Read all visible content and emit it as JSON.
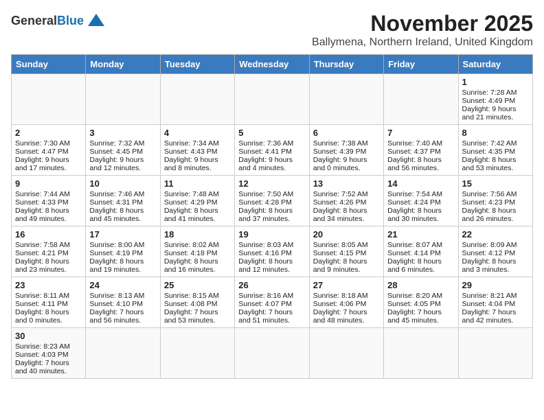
{
  "header": {
    "logo_line1": "General",
    "logo_line2": "Blue",
    "title": "November 2025",
    "subtitle": "Ballymena, Northern Ireland, United Kingdom"
  },
  "weekdays": [
    "Sunday",
    "Monday",
    "Tuesday",
    "Wednesday",
    "Thursday",
    "Friday",
    "Saturday"
  ],
  "weeks": [
    [
      {
        "day": "",
        "info": ""
      },
      {
        "day": "",
        "info": ""
      },
      {
        "day": "",
        "info": ""
      },
      {
        "day": "",
        "info": ""
      },
      {
        "day": "",
        "info": ""
      },
      {
        "day": "",
        "info": ""
      },
      {
        "day": "1",
        "info": "Sunrise: 7:28 AM\nSunset: 4:49 PM\nDaylight: 9 hours and 21 minutes."
      }
    ],
    [
      {
        "day": "2",
        "info": "Sunrise: 7:30 AM\nSunset: 4:47 PM\nDaylight: 9 hours and 17 minutes."
      },
      {
        "day": "3",
        "info": "Sunrise: 7:32 AM\nSunset: 4:45 PM\nDaylight: 9 hours and 12 minutes."
      },
      {
        "day": "4",
        "info": "Sunrise: 7:34 AM\nSunset: 4:43 PM\nDaylight: 9 hours and 8 minutes."
      },
      {
        "day": "5",
        "info": "Sunrise: 7:36 AM\nSunset: 4:41 PM\nDaylight: 9 hours and 4 minutes."
      },
      {
        "day": "6",
        "info": "Sunrise: 7:38 AM\nSunset: 4:39 PM\nDaylight: 9 hours and 0 minutes."
      },
      {
        "day": "7",
        "info": "Sunrise: 7:40 AM\nSunset: 4:37 PM\nDaylight: 8 hours and 56 minutes."
      },
      {
        "day": "8",
        "info": "Sunrise: 7:42 AM\nSunset: 4:35 PM\nDaylight: 8 hours and 53 minutes."
      }
    ],
    [
      {
        "day": "9",
        "info": "Sunrise: 7:44 AM\nSunset: 4:33 PM\nDaylight: 8 hours and 49 minutes."
      },
      {
        "day": "10",
        "info": "Sunrise: 7:46 AM\nSunset: 4:31 PM\nDaylight: 8 hours and 45 minutes."
      },
      {
        "day": "11",
        "info": "Sunrise: 7:48 AM\nSunset: 4:29 PM\nDaylight: 8 hours and 41 minutes."
      },
      {
        "day": "12",
        "info": "Sunrise: 7:50 AM\nSunset: 4:28 PM\nDaylight: 8 hours and 37 minutes."
      },
      {
        "day": "13",
        "info": "Sunrise: 7:52 AM\nSunset: 4:26 PM\nDaylight: 8 hours and 34 minutes."
      },
      {
        "day": "14",
        "info": "Sunrise: 7:54 AM\nSunset: 4:24 PM\nDaylight: 8 hours and 30 minutes."
      },
      {
        "day": "15",
        "info": "Sunrise: 7:56 AM\nSunset: 4:23 PM\nDaylight: 8 hours and 26 minutes."
      }
    ],
    [
      {
        "day": "16",
        "info": "Sunrise: 7:58 AM\nSunset: 4:21 PM\nDaylight: 8 hours and 23 minutes."
      },
      {
        "day": "17",
        "info": "Sunrise: 8:00 AM\nSunset: 4:19 PM\nDaylight: 8 hours and 19 minutes."
      },
      {
        "day": "18",
        "info": "Sunrise: 8:02 AM\nSunset: 4:18 PM\nDaylight: 8 hours and 16 minutes."
      },
      {
        "day": "19",
        "info": "Sunrise: 8:03 AM\nSunset: 4:16 PM\nDaylight: 8 hours and 12 minutes."
      },
      {
        "day": "20",
        "info": "Sunrise: 8:05 AM\nSunset: 4:15 PM\nDaylight: 8 hours and 9 minutes."
      },
      {
        "day": "21",
        "info": "Sunrise: 8:07 AM\nSunset: 4:14 PM\nDaylight: 8 hours and 6 minutes."
      },
      {
        "day": "22",
        "info": "Sunrise: 8:09 AM\nSunset: 4:12 PM\nDaylight: 8 hours and 3 minutes."
      }
    ],
    [
      {
        "day": "23",
        "info": "Sunrise: 8:11 AM\nSunset: 4:11 PM\nDaylight: 8 hours and 0 minutes."
      },
      {
        "day": "24",
        "info": "Sunrise: 8:13 AM\nSunset: 4:10 PM\nDaylight: 7 hours and 56 minutes."
      },
      {
        "day": "25",
        "info": "Sunrise: 8:15 AM\nSunset: 4:08 PM\nDaylight: 7 hours and 53 minutes."
      },
      {
        "day": "26",
        "info": "Sunrise: 8:16 AM\nSunset: 4:07 PM\nDaylight: 7 hours and 51 minutes."
      },
      {
        "day": "27",
        "info": "Sunrise: 8:18 AM\nSunset: 4:06 PM\nDaylight: 7 hours and 48 minutes."
      },
      {
        "day": "28",
        "info": "Sunrise: 8:20 AM\nSunset: 4:05 PM\nDaylight: 7 hours and 45 minutes."
      },
      {
        "day": "29",
        "info": "Sunrise: 8:21 AM\nSunset: 4:04 PM\nDaylight: 7 hours and 42 minutes."
      }
    ],
    [
      {
        "day": "30",
        "info": "Sunrise: 8:23 AM\nSunset: 4:03 PM\nDaylight: 7 hours and 40 minutes."
      },
      {
        "day": "",
        "info": ""
      },
      {
        "day": "",
        "info": ""
      },
      {
        "day": "",
        "info": ""
      },
      {
        "day": "",
        "info": ""
      },
      {
        "day": "",
        "info": ""
      },
      {
        "day": "",
        "info": ""
      }
    ]
  ]
}
